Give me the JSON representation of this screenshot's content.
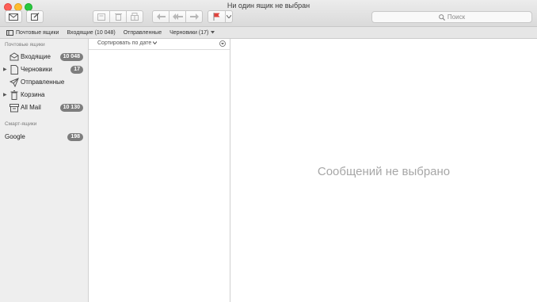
{
  "window": {
    "title": "Ни один ящик не выбран"
  },
  "toolbar": {
    "buttons": [
      {
        "name": "get-mail",
        "icon": "envelope-icon"
      },
      {
        "name": "compose",
        "icon": "compose-icon"
      },
      {
        "name": "archive",
        "icon": "archive-icon"
      },
      {
        "name": "delete",
        "icon": "trash-icon"
      },
      {
        "name": "junk",
        "icon": "junk-icon"
      },
      {
        "name": "reply",
        "icon": "reply-icon"
      },
      {
        "name": "reply-all",
        "icon": "reply-all-icon"
      },
      {
        "name": "forward",
        "icon": "forward-icon"
      },
      {
        "name": "flag",
        "icon": "flag-icon"
      }
    ],
    "flag_color": "#e0443e"
  },
  "search": {
    "placeholder": "Поиск"
  },
  "favorites": {
    "mailboxes": "Почтовые ящики",
    "inbox": "Входящие (10 048)",
    "sent": "Отправленные",
    "drafts": "Черновики (17)"
  },
  "sidebar": {
    "section_mailboxes": "Почтовые ящики",
    "items": [
      {
        "label": "Входящие",
        "badge": "10 048",
        "icon": "inbox-icon"
      },
      {
        "label": "Черновики",
        "badge": "17",
        "icon": "draft-icon"
      },
      {
        "label": "Отправленные",
        "badge": "",
        "icon": "paper-plane-icon"
      },
      {
        "label": "Корзина",
        "badge": "",
        "icon": "trash-icon"
      },
      {
        "label": "All Mail",
        "badge": "10 130",
        "icon": "archive-box-icon"
      }
    ],
    "section_smart": "Смарт-ящики",
    "smart": [
      {
        "label": "Google",
        "badge": "198"
      }
    ]
  },
  "message_list": {
    "sort_label": "Сортировать по дате"
  },
  "preview": {
    "empty_text": "Сообщений не выбрано"
  },
  "colors": {
    "badge": "#7d7d7d",
    "close": "#fe5f57",
    "minimize": "#febc2e",
    "maximize": "#28c840"
  }
}
